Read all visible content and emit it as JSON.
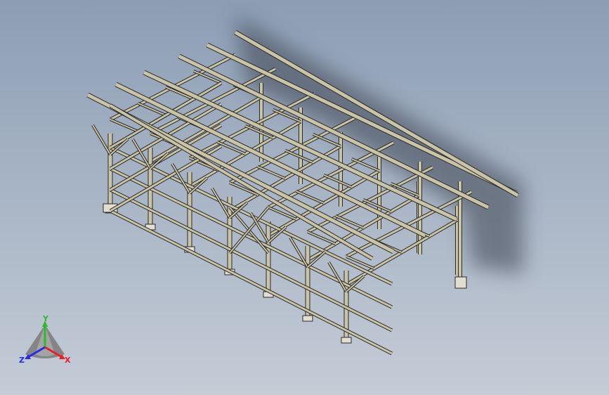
{
  "viewport": {
    "background_top": "#8c9db4",
    "background_bottom": "#c4ccd6",
    "model": "steel-frame-structure"
  },
  "colors": {
    "member_fill": "#c9c3a8",
    "member_edge": "#2a2a26",
    "shadow": "#3a4250",
    "baseplate": "#e2dfd2"
  },
  "triad": {
    "x_label": "X",
    "y_label": "Y",
    "z_label": "Z",
    "x_color": "#e8202a",
    "y_color": "#2bbb2b",
    "z_color": "#2a2ae6"
  }
}
